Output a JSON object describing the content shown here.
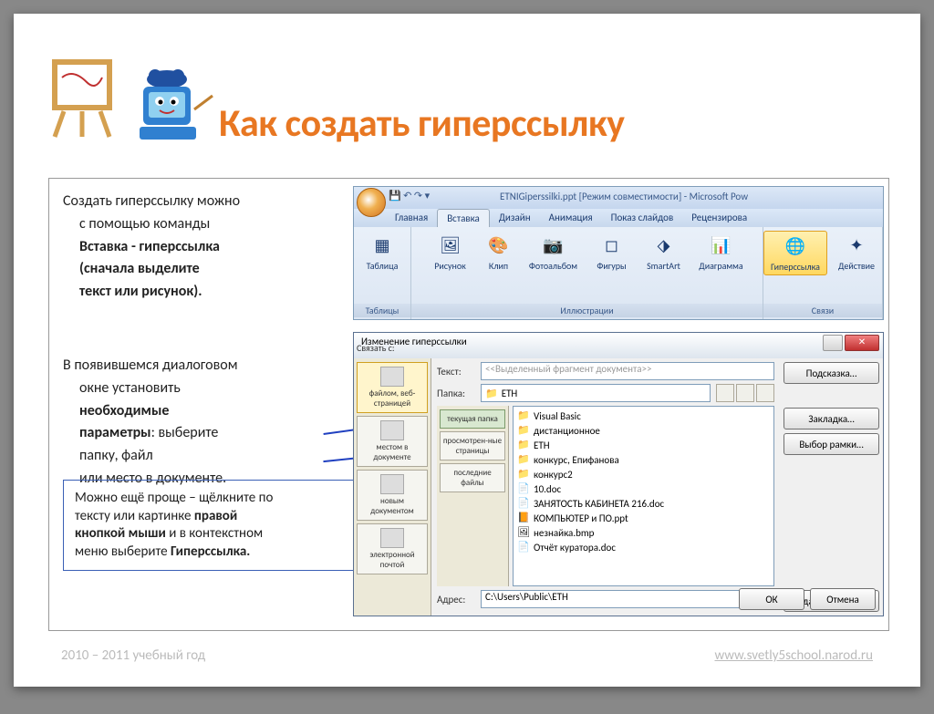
{
  "title": "Как создать гиперссылку",
  "para1": {
    "l1": "Создать гиперссылку можно",
    "l2": "с помощью команды",
    "l3": "Вставка  - гиперссылка",
    "l4": "(сначала выделите",
    "l5": "текст или рисунок)."
  },
  "para2": {
    "l1": "В появившемся диалоговом",
    "l2": "окне установить",
    "l3": "необходимые",
    "l4": "параметры",
    "l4b": ": выберите",
    "l5": "папку, файл",
    "l6": "или место в документе."
  },
  "tip": {
    "t1": "Можно ещё проще – щёлкните по",
    "t2": "тексту или картинке ",
    "t2b": "правой",
    "t3": "кнопкой мыши",
    "t3b": " и в контекстном",
    "t4": "меню выберите ",
    "t4b": "Гиперссылка."
  },
  "ribbon": {
    "doctitle": "ETNIGiperssilki.ppt [Режим совместимости] - Microsoft Pow",
    "tabs": [
      "Главная",
      "Вставка",
      "Дизайн",
      "Анимация",
      "Показ слайдов",
      "Рецензирова"
    ],
    "groups": {
      "tables": "Таблицы",
      "illus": "Иллюстрации",
      "links": "Связи"
    },
    "buttons": {
      "table": "Таблица",
      "picture": "Рисунок",
      "clip": "Клип",
      "album": "Фотоальбом",
      "shapes": "Фигуры",
      "smartart": "SmartArt",
      "chart": "Диаграмма",
      "hyperlink": "Гиперссылка",
      "action": "Действие"
    }
  },
  "dialog": {
    "title": "Изменение гиперссылки",
    "linkto_label": "Связать с:",
    "text_label": "Текст:",
    "text_value": "<<Выделенный фрагмент документа>>",
    "folder_label": "Папка:",
    "folder_value": "ETH",
    "address_label": "Адрес:",
    "address_value": "C:\\Users\\Public\\ETH",
    "left": [
      "файлом, веб-страницей",
      "местом в документе",
      "новым документом",
      "электронной почтой"
    ],
    "mid": [
      "текущая папка",
      "просмотрен-ные страницы",
      "последние файлы"
    ],
    "files": [
      {
        "name": "Visual Basic",
        "type": "folder"
      },
      {
        "name": "дистанционное",
        "type": "folder"
      },
      {
        "name": "ETH",
        "type": "folder"
      },
      {
        "name": "конкурс, Епифанова",
        "type": "folder"
      },
      {
        "name": "конкурс2",
        "type": "folder"
      },
      {
        "name": "10.doc",
        "type": "doc"
      },
      {
        "name": "ЗАНЯТОСТЬ КАБИНЕТА   216.doc",
        "type": "doc"
      },
      {
        "name": "КОМПЬЮТЕР и ПО.ppt",
        "type": "ppt"
      },
      {
        "name": "незнайка.bmp",
        "type": "img"
      },
      {
        "name": "Отчёт куратора.doc",
        "type": "doc"
      }
    ],
    "buttons": {
      "hint": "Подсказка…",
      "bookmark": "Закладка…",
      "frame": "Выбор рамки…",
      "remove": "Удалить ссылку",
      "ok": "ОК",
      "cancel": "Отмена"
    }
  },
  "footer": {
    "left": "2010 – 2011 учебный год",
    "right": "www.svetly5school.narod.ru"
  }
}
